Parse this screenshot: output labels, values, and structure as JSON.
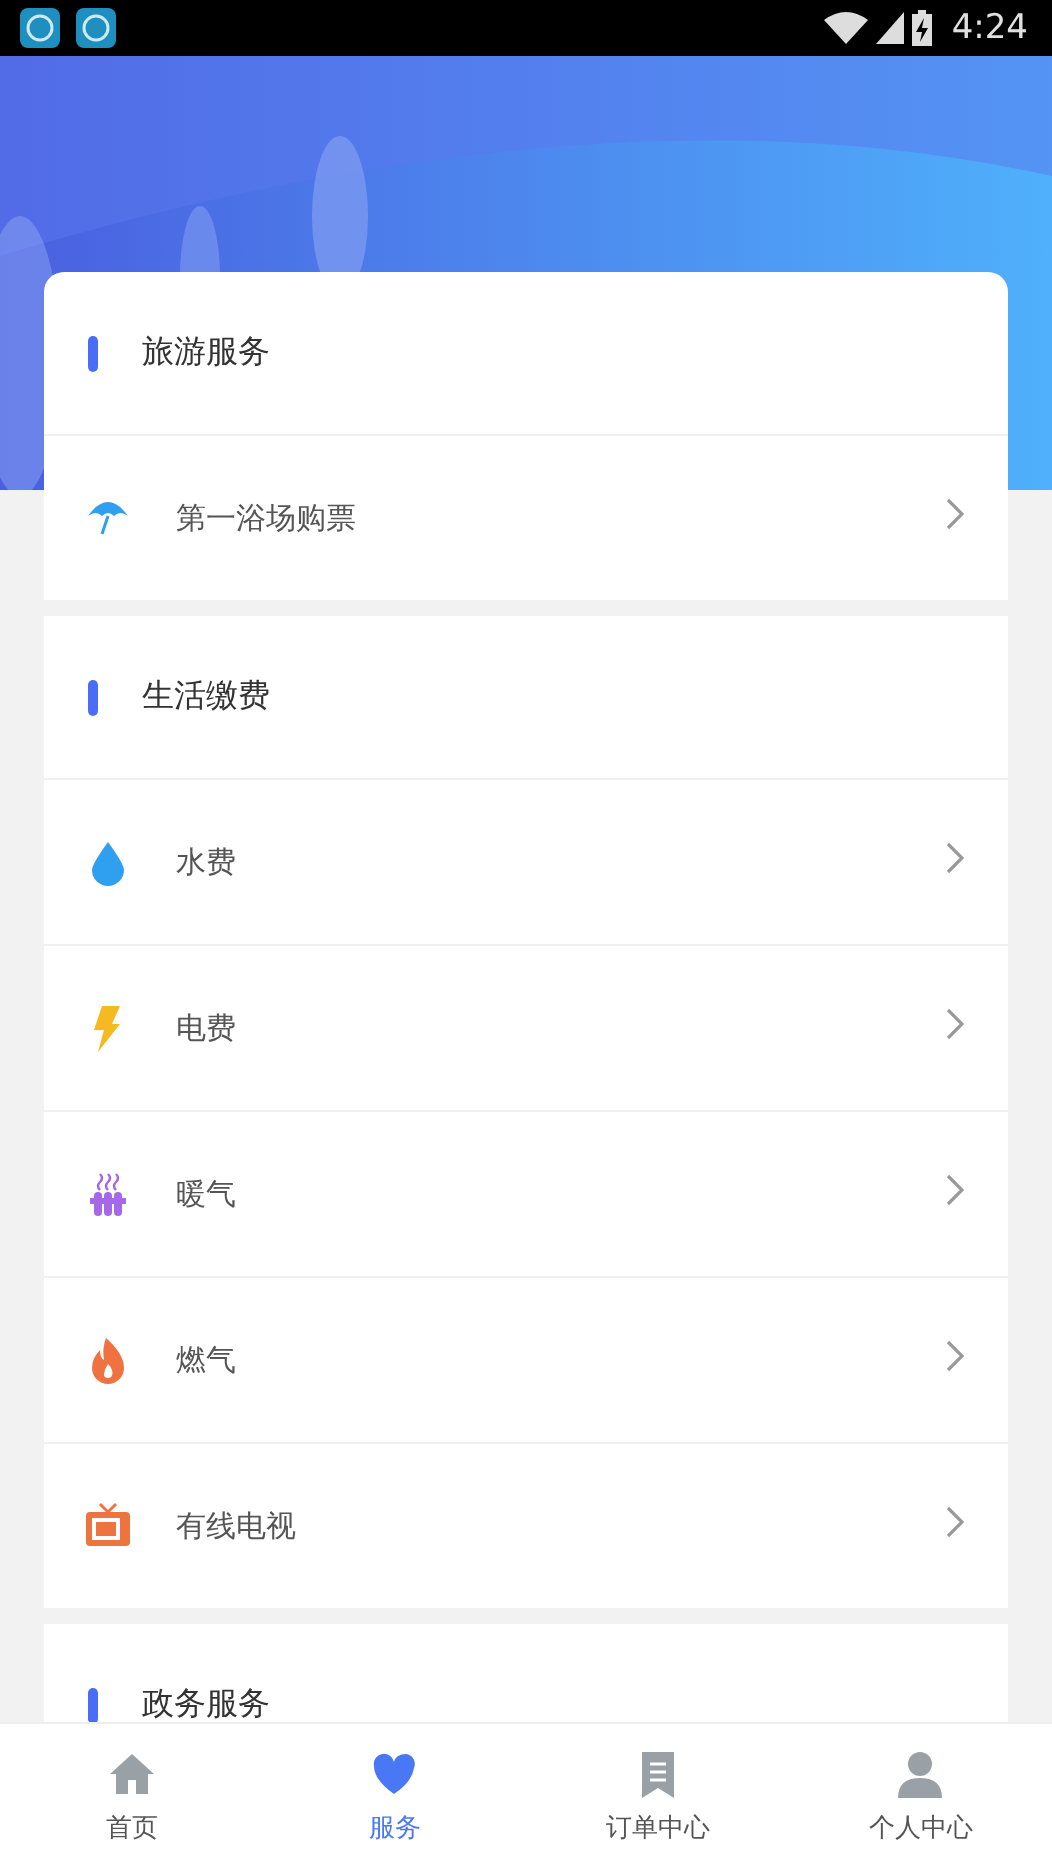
{
  "status_bar": {
    "time": "4:24"
  },
  "sections": [
    {
      "title": "旅游服务",
      "items": [
        {
          "kind": "umbrella",
          "label": "第一浴场购票"
        }
      ]
    },
    {
      "title": "生活缴费",
      "items": [
        {
          "kind": "drop",
          "label": "水费"
        },
        {
          "kind": "bolt",
          "label": "电费"
        },
        {
          "kind": "radiator",
          "label": "暖气"
        },
        {
          "kind": "flame",
          "label": "燃气"
        },
        {
          "kind": "tv",
          "label": "有线电视"
        }
      ]
    },
    {
      "title": "政务服务"
    }
  ],
  "tab_bar": [
    {
      "kind": "home",
      "label": "首页",
      "selected": false
    },
    {
      "kind": "heart",
      "label": "服务",
      "selected": true
    },
    {
      "kind": "doc",
      "label": "订单中心",
      "selected": false
    },
    {
      "kind": "person",
      "label": "个人中心",
      "selected": false
    }
  ]
}
